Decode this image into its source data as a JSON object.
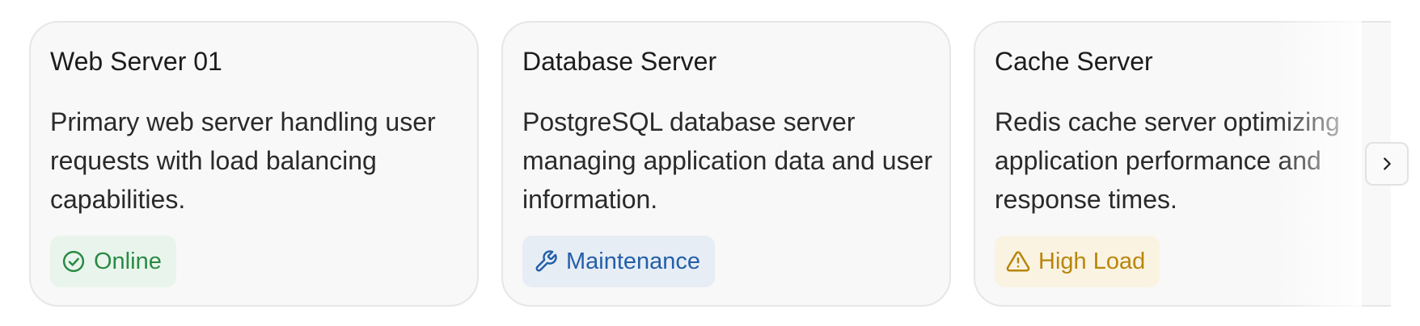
{
  "cards": [
    {
      "title": "Web Server 01",
      "description": "Primary web server handling user requests with load balancing capabilities.",
      "status": {
        "label": "Online",
        "icon": "check-circle-icon",
        "color": "#2a8a44",
        "bg": "#e9f5ec"
      }
    },
    {
      "title": "Database Server",
      "description": "PostgreSQL database server managing application data and user information.",
      "status": {
        "label": "Maintenance",
        "icon": "wrench-icon",
        "color": "#235fa8",
        "bg": "#e7edf5"
      }
    },
    {
      "title": "Cache Server",
      "description": "Redis cache server optimizing application performance and response times.",
      "status": {
        "label": "High Load",
        "icon": "warning-triangle-icon",
        "color": "#b8860b",
        "bg": "#fbf3e2"
      }
    }
  ],
  "carousel": {
    "next_icon": "chevron-right-icon"
  }
}
